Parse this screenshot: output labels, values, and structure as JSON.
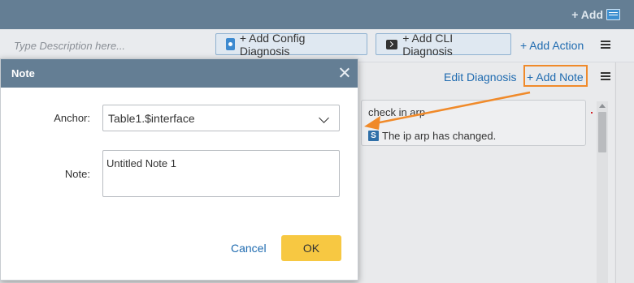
{
  "header": {
    "add_label": "+ Add",
    "add_icon": "panel-icon"
  },
  "toolbar": {
    "description_placeholder": "Type Description here...",
    "config_diag_label": "+ Add Config Diagnosis",
    "cli_diag_label": "+ Add CLI Diagnosis",
    "add_action_label": "+ Add Action"
  },
  "panel": {
    "edit_diag_label": "Edit Diagnosis",
    "add_note_label": "+ Add Note",
    "card": {
      "title": "check in arp",
      "icon_letter": "S",
      "message": "The ip arp has changed."
    }
  },
  "modal": {
    "title": "Note",
    "anchor_label": "Anchor:",
    "anchor_value": "Table1.$interface",
    "note_label": "Note:",
    "note_value": "Untitled Note 1",
    "cancel_label": "Cancel",
    "ok_label": "OK"
  },
  "colors": {
    "header": "#647e94",
    "link": "#1f6bb0",
    "ok_button": "#f7c842",
    "annotation": "#f08a2a"
  }
}
